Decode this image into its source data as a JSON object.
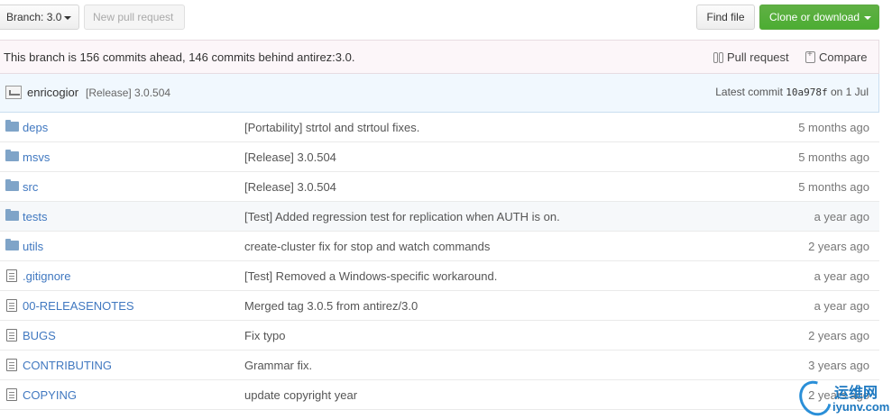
{
  "toolbar": {
    "branch_label": "Branch: 3.0",
    "new_pull_request": "New pull request",
    "find_file": "Find file",
    "clone_download": "Clone or download"
  },
  "branch_info": {
    "message": "This branch is 156 commits ahead, 146 commits behind antirez:3.0.",
    "pull_request": "Pull request",
    "compare": "Compare"
  },
  "latest_commit": {
    "author": "enricogior",
    "message": "[Release] 3.0.504",
    "latest_label": "Latest commit",
    "sha": "10a978f",
    "date": "on 1 Jul"
  },
  "files": [
    {
      "type": "folder",
      "name": "deps",
      "message": "[Portability] strtol and strtoul fixes.",
      "age": "5 months ago"
    },
    {
      "type": "folder",
      "name": "msvs",
      "message": "[Release] 3.0.504",
      "age": "5 months ago"
    },
    {
      "type": "folder",
      "name": "src",
      "message": "[Release] 3.0.504",
      "age": "5 months ago"
    },
    {
      "type": "folder",
      "name": "tests",
      "message": "[Test] Added regression test for replication when AUTH is on.",
      "age": "a year ago"
    },
    {
      "type": "folder",
      "name": "utils",
      "message": "create-cluster fix for stop and watch commands",
      "age": "2 years ago"
    },
    {
      "type": "file",
      "name": ".gitignore",
      "message": "[Test] Removed a Windows-specific workaround.",
      "age": "a year ago"
    },
    {
      "type": "file",
      "name": "00-RELEASENOTES",
      "message": "Merged tag 3.0.5 from antirez/3.0",
      "age": "a year ago"
    },
    {
      "type": "file",
      "name": "BUGS",
      "message": "Fix typo",
      "age": "2 years ago"
    },
    {
      "type": "file",
      "name": "CONTRIBUTING",
      "message": "Grammar fix.",
      "age": "3 years ago"
    },
    {
      "type": "file",
      "name": "COPYING",
      "message": "update copyright year",
      "age": "2 years ago"
    }
  ],
  "watermark": {
    "line1": "运维网",
    "line2": "iyunv.com"
  },
  "colors": {
    "link": "#4078c0",
    "clone_button": "#55a532",
    "folder": "#7fa4c8"
  }
}
